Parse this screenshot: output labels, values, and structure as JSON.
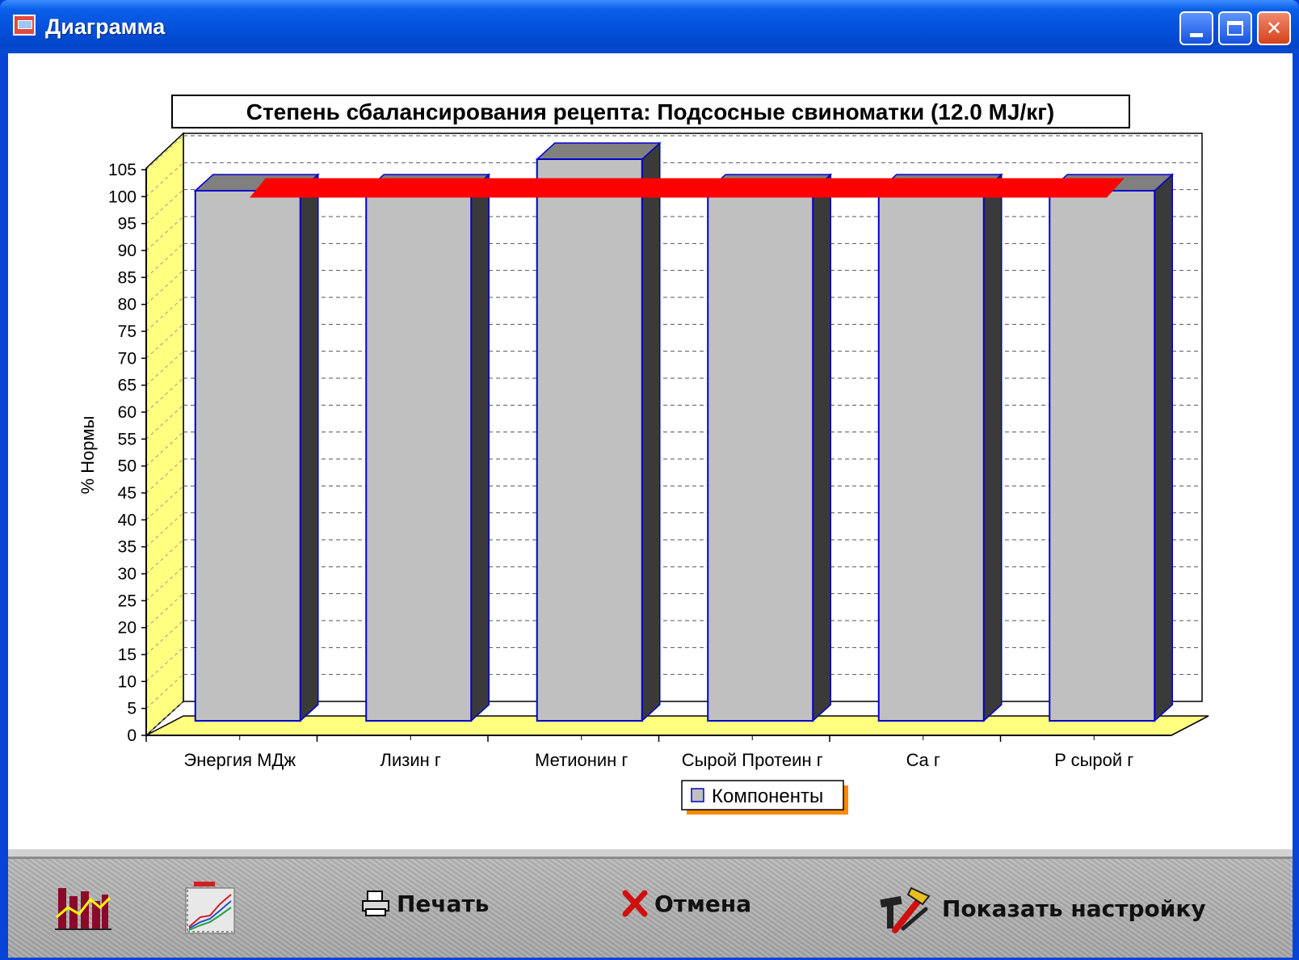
{
  "window": {
    "title": "Диаграмма"
  },
  "chart_data": {
    "type": "bar",
    "title": "Степень сбалансирования рецепта: Подсосные свиноматки (12.0 MJ/кг)",
    "xlabel": "",
    "ylabel": "% Нормы",
    "categories": [
      "Энергия МДж",
      "Лизин г",
      "Метионин г",
      "Сырой Протеин г",
      "Ca г",
      "P сырой г"
    ],
    "series": [
      {
        "name": "Компоненты",
        "values": [
          101,
          101,
          107,
          101,
          101,
          101
        ]
      }
    ],
    "reference_line": {
      "value": 100,
      "color": "#ff0000"
    },
    "ylim": [
      0,
      105
    ],
    "yticks": [
      0,
      5,
      10,
      15,
      20,
      25,
      30,
      35,
      40,
      45,
      50,
      55,
      60,
      65,
      70,
      75,
      80,
      85,
      90,
      95,
      100,
      105
    ],
    "grid": true,
    "legend_position": "bottom",
    "style": "3d",
    "bar_color": "#c0c0c0",
    "bar_edge_color": "#0000cc",
    "wall_color": "#ffff80"
  },
  "toolbar": {
    "bar_chart_icon": "bar-chart-icon",
    "line_chart_icon": "line-chart-icon",
    "print_label": "Печать",
    "cancel_label": "Отмена",
    "settings_label": "Показать настройку"
  }
}
